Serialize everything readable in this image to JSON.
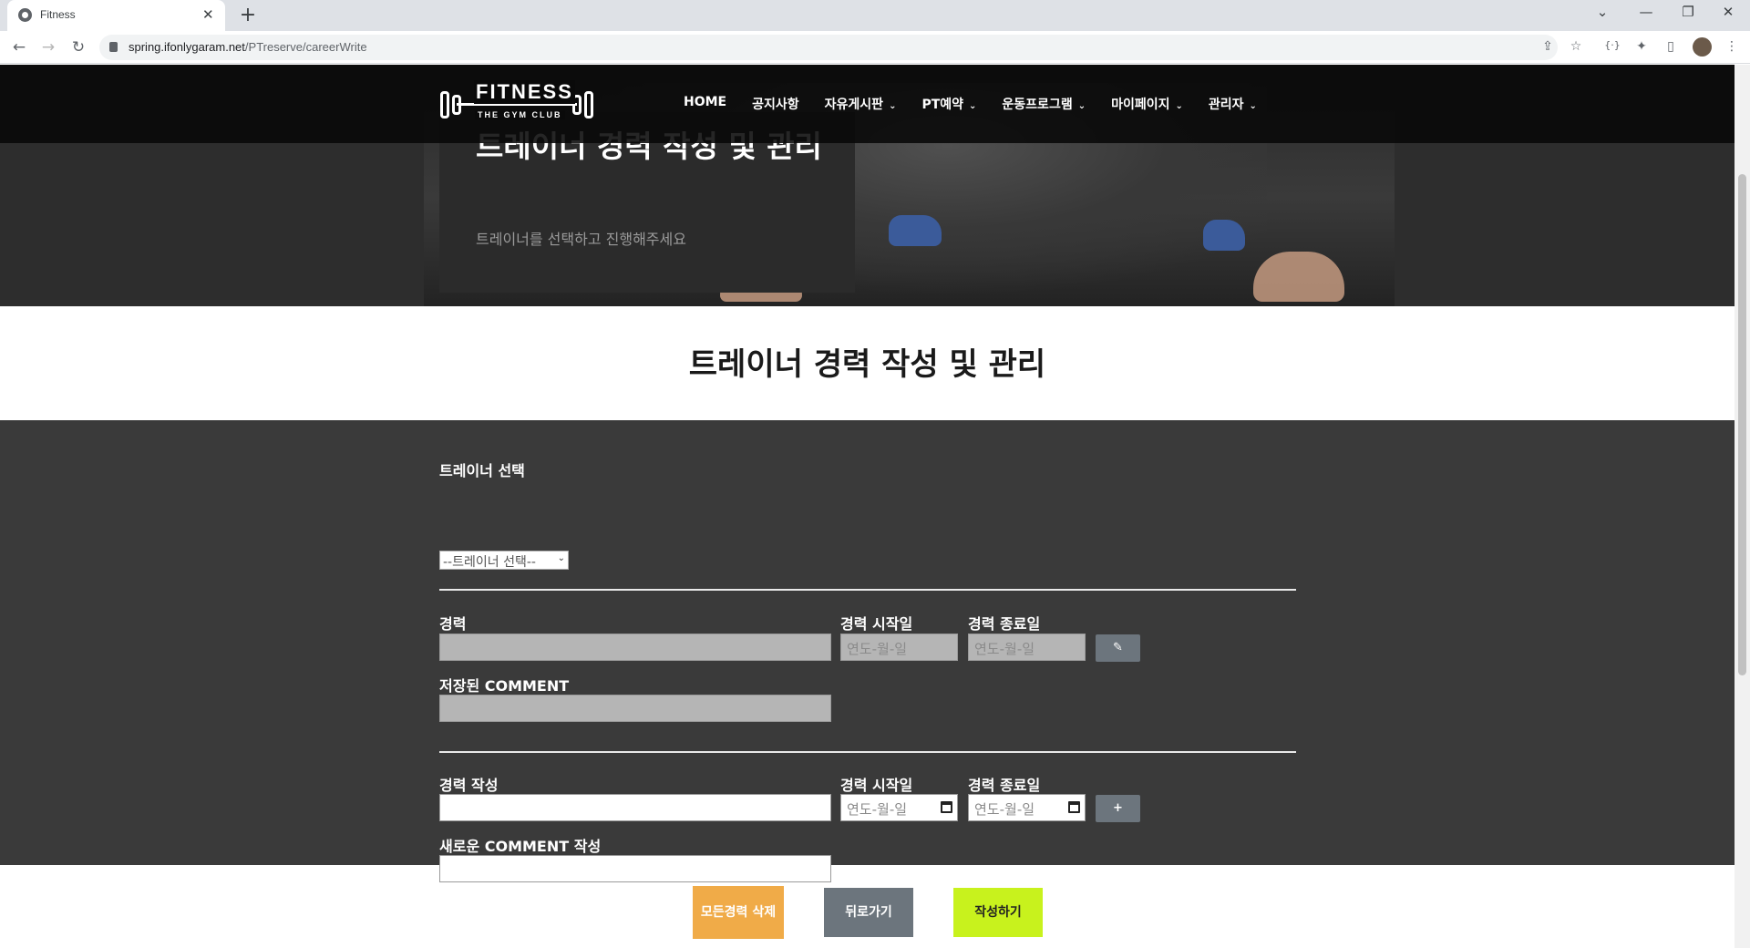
{
  "browser": {
    "tab_title": "Fitness",
    "tab_close": "✕",
    "new_tab": "+",
    "url_domain": "spring.ifonlygaram.net",
    "url_path": "/PTreserve/careerWrite",
    "win_controls": [
      "⌄",
      "—",
      "❐",
      "✕"
    ]
  },
  "nav": {
    "logo_title": "FITNESS",
    "logo_sub": "THE GYM CLUB",
    "menu": [
      {
        "label": "HOME",
        "dropdown": false
      },
      {
        "label": "공지사항",
        "dropdown": false
      },
      {
        "label": "자유게시판",
        "dropdown": true
      },
      {
        "label": "PT예약",
        "dropdown": true
      },
      {
        "label": "운동프로그램",
        "dropdown": true
      },
      {
        "label": "마이페이지",
        "dropdown": true
      },
      {
        "label": "관리자",
        "dropdown": true
      }
    ]
  },
  "hero": {
    "title": "트레이너 경력 작성 및 관리",
    "subtitle": "트레이너를 선택하고 진행해주세요"
  },
  "page_title": "트레이너 경력 작성 및 관리",
  "form": {
    "trainer_label": "트레이너 선택",
    "trainer_select_value": "--트레이너 선택--",
    "saved": {
      "career_label": "경력",
      "start_label": "경력 시작일",
      "end_label": "경력 종료일",
      "start_placeholder": "연도-월-일",
      "end_placeholder": "연도-월-일",
      "comment_label": "저장된 COMMENT",
      "edit_icon": "edit-icon"
    },
    "new": {
      "career_label": "경력 작성",
      "start_label": "경력 시작일",
      "end_label": "경력 종료일",
      "start_placeholder": "연도-월-일",
      "end_placeholder": "연도-월-일",
      "comment_label": "새로운 COMMENT 작성",
      "add_label": "+"
    }
  },
  "buttons": {
    "delete_all": "모든경력 삭제",
    "back": "뒤로가기",
    "write": "작성하기"
  },
  "colors": {
    "delete": "#f0ab48",
    "back": "#6c757d",
    "write": "#c8f21d",
    "panel": "#3a3a3a"
  }
}
